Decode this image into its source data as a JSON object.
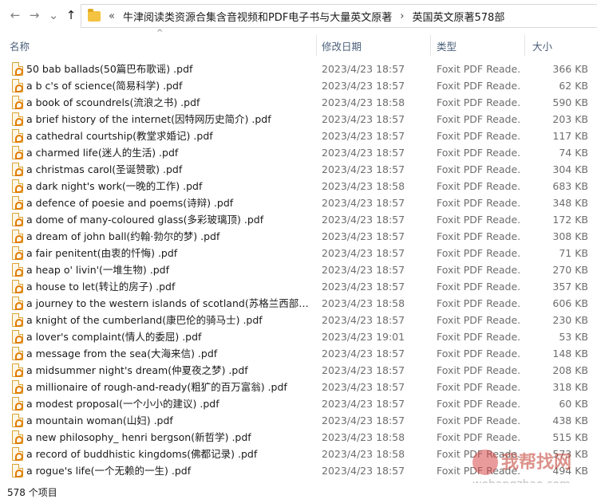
{
  "nav": {
    "back_glyph": "←",
    "forward_glyph": "→",
    "recent_glyph": "⌄",
    "up_glyph": "↑"
  },
  "address": {
    "overflow": "«",
    "crumbs": [
      "牛津阅读类资源合集含音视频和PDF电子书与大量英文原著",
      "英国英文原著578部"
    ],
    "separator": "›"
  },
  "columns": {
    "name": "名称",
    "date": "修改日期",
    "type": "类型",
    "size": "大小"
  },
  "files": [
    {
      "name": "50 bab ballads(50篇巴布歌谣) .pdf",
      "date": "2023/4/23 18:57",
      "type": "Foxit PDF Reade...",
      "size": "366 KB"
    },
    {
      "name": "a b c's of science(简易科学) .pdf",
      "date": "2023/4/23 18:57",
      "type": "Foxit PDF Reade...",
      "size": "62 KB"
    },
    {
      "name": "a book of scoundrels(流浪之书) .pdf",
      "date": "2023/4/23 18:58",
      "type": "Foxit PDF Reade...",
      "size": "590 KB"
    },
    {
      "name": "a brief history of the internet(因特网历史简介) .pdf",
      "date": "2023/4/23 18:57",
      "type": "Foxit PDF Reade...",
      "size": "203 KB"
    },
    {
      "name": "a cathedral courtship(教堂求婚记) .pdf",
      "date": "2023/4/23 18:57",
      "type": "Foxit PDF Reade...",
      "size": "117 KB"
    },
    {
      "name": "a charmed life(迷人的生活) .pdf",
      "date": "2023/4/23 18:57",
      "type": "Foxit PDF Reade...",
      "size": "74 KB"
    },
    {
      "name": "a christmas carol(圣诞赞歌) .pdf",
      "date": "2023/4/23 18:57",
      "type": "Foxit PDF Reade...",
      "size": "304 KB"
    },
    {
      "name": "a dark night's work(一晚的工作) .pdf",
      "date": "2023/4/23 18:58",
      "type": "Foxit PDF Reade...",
      "size": "683 KB"
    },
    {
      "name": "a defence of poesie and poems(诗辩) .pdf",
      "date": "2023/4/23 18:57",
      "type": "Foxit PDF Reade...",
      "size": "348 KB"
    },
    {
      "name": "a dome of many-coloured glass(多彩玻璃顶) .pdf",
      "date": "2023/4/23 18:57",
      "type": "Foxit PDF Reade...",
      "size": "172 KB"
    },
    {
      "name": "a dream of john ball(约翰·勃尔的梦) .pdf",
      "date": "2023/4/23 18:57",
      "type": "Foxit PDF Reade...",
      "size": "308 KB"
    },
    {
      "name": "a fair penitent(由衷的忏悔) .pdf",
      "date": "2023/4/23 18:57",
      "type": "Foxit PDF Reade...",
      "size": "71 KB"
    },
    {
      "name": "a heap o' livin'(一堆生物) .pdf",
      "date": "2023/4/23 18:57",
      "type": "Foxit PDF Reade...",
      "size": "270 KB"
    },
    {
      "name": "a house to let(转让的房子) .pdf",
      "date": "2023/4/23 18:57",
      "type": "Foxit PDF Reade...",
      "size": "357 KB"
    },
    {
      "name": "a journey to the western islands of scotland(苏格兰西部群岛)...",
      "date": "2023/4/23 18:58",
      "type": "Foxit PDF Reade...",
      "size": "606 KB"
    },
    {
      "name": "a knight of the cumberland(康巴伦的骑马士) .pdf",
      "date": "2023/4/23 18:57",
      "type": "Foxit PDF Reade...",
      "size": "230 KB"
    },
    {
      "name": "a lover's complaint(情人的委屈) .pdf",
      "date": "2023/4/23 19:01",
      "type": "Foxit PDF Reade...",
      "size": "53 KB"
    },
    {
      "name": "a message from the sea(大海来信) .pdf",
      "date": "2023/4/23 18:57",
      "type": "Foxit PDF Reade...",
      "size": "148 KB"
    },
    {
      "name": "a midsummer night's dream(仲夏夜之梦) .pdf",
      "date": "2023/4/23 18:57",
      "type": "Foxit PDF Reade...",
      "size": "208 KB"
    },
    {
      "name": "a millionaire of rough-and-ready(粗犷的百万富翁) .pdf",
      "date": "2023/4/23 18:57",
      "type": "Foxit PDF Reade...",
      "size": "318 KB"
    },
    {
      "name": "a modest proposal(一个小小的建议) .pdf",
      "date": "2023/4/23 18:57",
      "type": "Foxit PDF Reade...",
      "size": "60 KB"
    },
    {
      "name": "a mountain woman(山妇) .pdf",
      "date": "2023/4/23 18:57",
      "type": "Foxit PDF Reade...",
      "size": "438 KB"
    },
    {
      "name": "a new philosophy_ henri bergson(新哲学) .pdf",
      "date": "2023/4/23 18:58",
      "type": "Foxit PDF Reade...",
      "size": "515 KB"
    },
    {
      "name": "a record of buddhistic kingdoms(佛都记录) .pdf",
      "date": "2023/4/23 18:58",
      "type": "Foxit PDF Reade...",
      "size": "573 KB"
    },
    {
      "name": "a rogue's life(一个无赖的一生) .pdf",
      "date": "2023/4/23 18:57",
      "type": "Foxit PDF Reade...",
      "size": "494 KB"
    }
  ],
  "status": {
    "count_text": "578 个项目"
  },
  "watermark": {
    "text": "我帮找网",
    "url": "wobangzhao.com"
  }
}
